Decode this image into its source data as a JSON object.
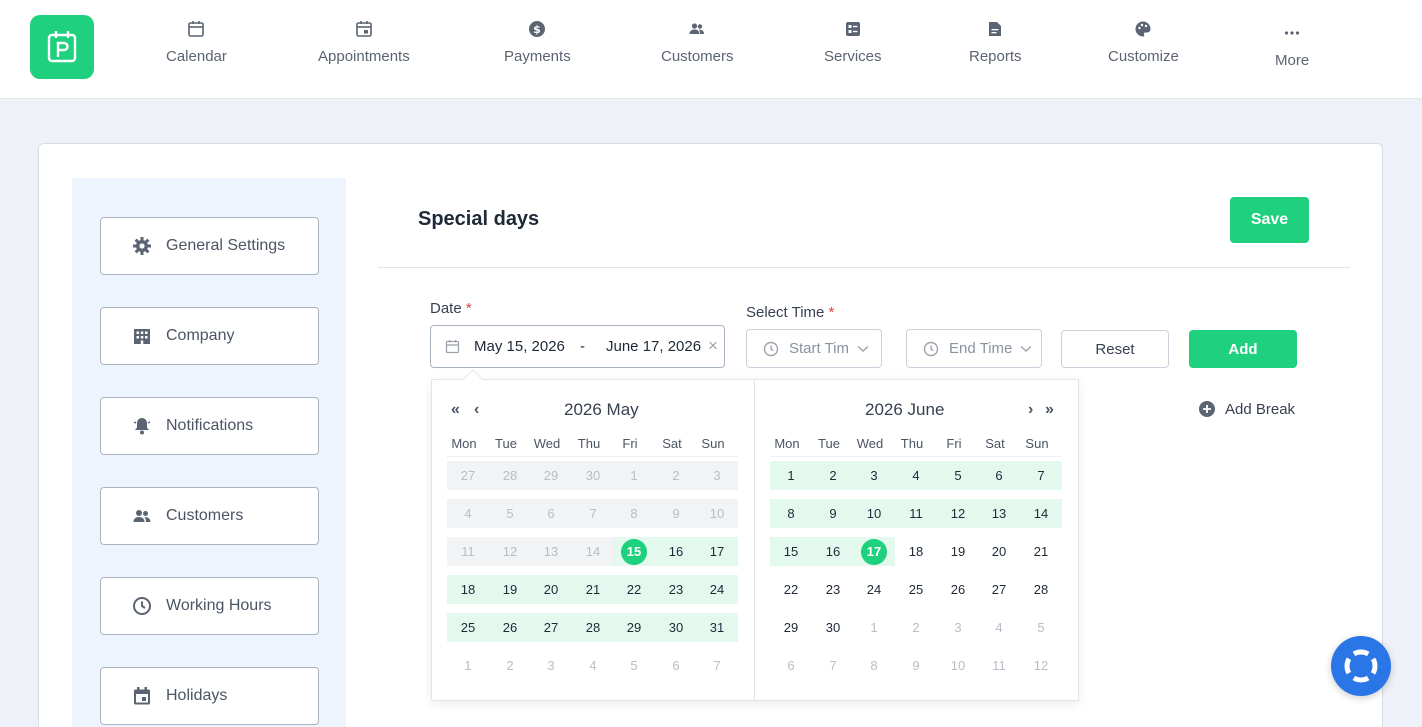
{
  "nav": {
    "items": [
      {
        "label": "Calendar",
        "icon": "calendar-icon"
      },
      {
        "label": "Appointments",
        "icon": "appointment-icon"
      },
      {
        "label": "Payments",
        "icon": "dollar-icon"
      },
      {
        "label": "Customers",
        "icon": "users-icon"
      },
      {
        "label": "Services",
        "icon": "services-icon"
      },
      {
        "label": "Reports",
        "icon": "report-icon"
      },
      {
        "label": "Customize",
        "icon": "palette-icon"
      },
      {
        "label": "More",
        "icon": "more-icon"
      }
    ]
  },
  "sidebar": {
    "items": [
      {
        "label": "General Settings",
        "icon": "gear-icon"
      },
      {
        "label": "Company",
        "icon": "building-icon"
      },
      {
        "label": "Notifications",
        "icon": "bell-icon"
      },
      {
        "label": "Customers",
        "icon": "users-icon"
      },
      {
        "label": "Working Hours",
        "icon": "clock-icon"
      },
      {
        "label": "Holidays",
        "icon": "calendar-icon"
      }
    ]
  },
  "main": {
    "title": "Special days",
    "save_label": "Save",
    "date_label": "Date",
    "required_mark": "*",
    "date_start": "May 15, 2026",
    "date_sep": "-",
    "date_end": "June 17, 2026",
    "clear_glyph": "×",
    "time_label": "Select Time",
    "start_time_placeholder": "Start Tim",
    "end_time_placeholder": "End Time",
    "reset_label": "Reset",
    "add_label": "Add",
    "add_break_label": "Add Break"
  },
  "picker": {
    "weekdays": [
      "Mon",
      "Tue",
      "Wed",
      "Thu",
      "Fri",
      "Sat",
      "Sun"
    ],
    "nav_prev_year": "«",
    "nav_prev_month": "‹",
    "nav_next_month": "›",
    "nav_next_year": "»",
    "left": {
      "title": "2026 May",
      "weeks": [
        [
          "27",
          "28",
          "29",
          "30",
          "1",
          "2",
          "3"
        ],
        [
          "4",
          "5",
          "6",
          "7",
          "8",
          "9",
          "10"
        ],
        [
          "11",
          "12",
          "13",
          "14",
          "15",
          "16",
          "17"
        ],
        [
          "18",
          "19",
          "20",
          "21",
          "22",
          "23",
          "24"
        ],
        [
          "25",
          "26",
          "27",
          "28",
          "29",
          "30",
          "31"
        ],
        [
          "1",
          "2",
          "3",
          "4",
          "5",
          "6",
          "7"
        ]
      ]
    },
    "right": {
      "title": "2026 June",
      "weeks": [
        [
          "1",
          "2",
          "3",
          "4",
          "5",
          "6",
          "7"
        ],
        [
          "8",
          "9",
          "10",
          "11",
          "12",
          "13",
          "14"
        ],
        [
          "15",
          "16",
          "17",
          "18",
          "19",
          "20",
          "21"
        ],
        [
          "22",
          "23",
          "24",
          "25",
          "26",
          "27",
          "28"
        ],
        [
          "29",
          "30",
          "1",
          "2",
          "3",
          "4",
          "5"
        ],
        [
          "6",
          "7",
          "8",
          "9",
          "10",
          "11",
          "12"
        ]
      ]
    },
    "range_start": "2026-05-15",
    "range_end": "2026-06-17"
  },
  "colors": {
    "accent": "#1fd07f",
    "range_fill": "#e3f9ee",
    "help_button": "#2b76e6"
  }
}
